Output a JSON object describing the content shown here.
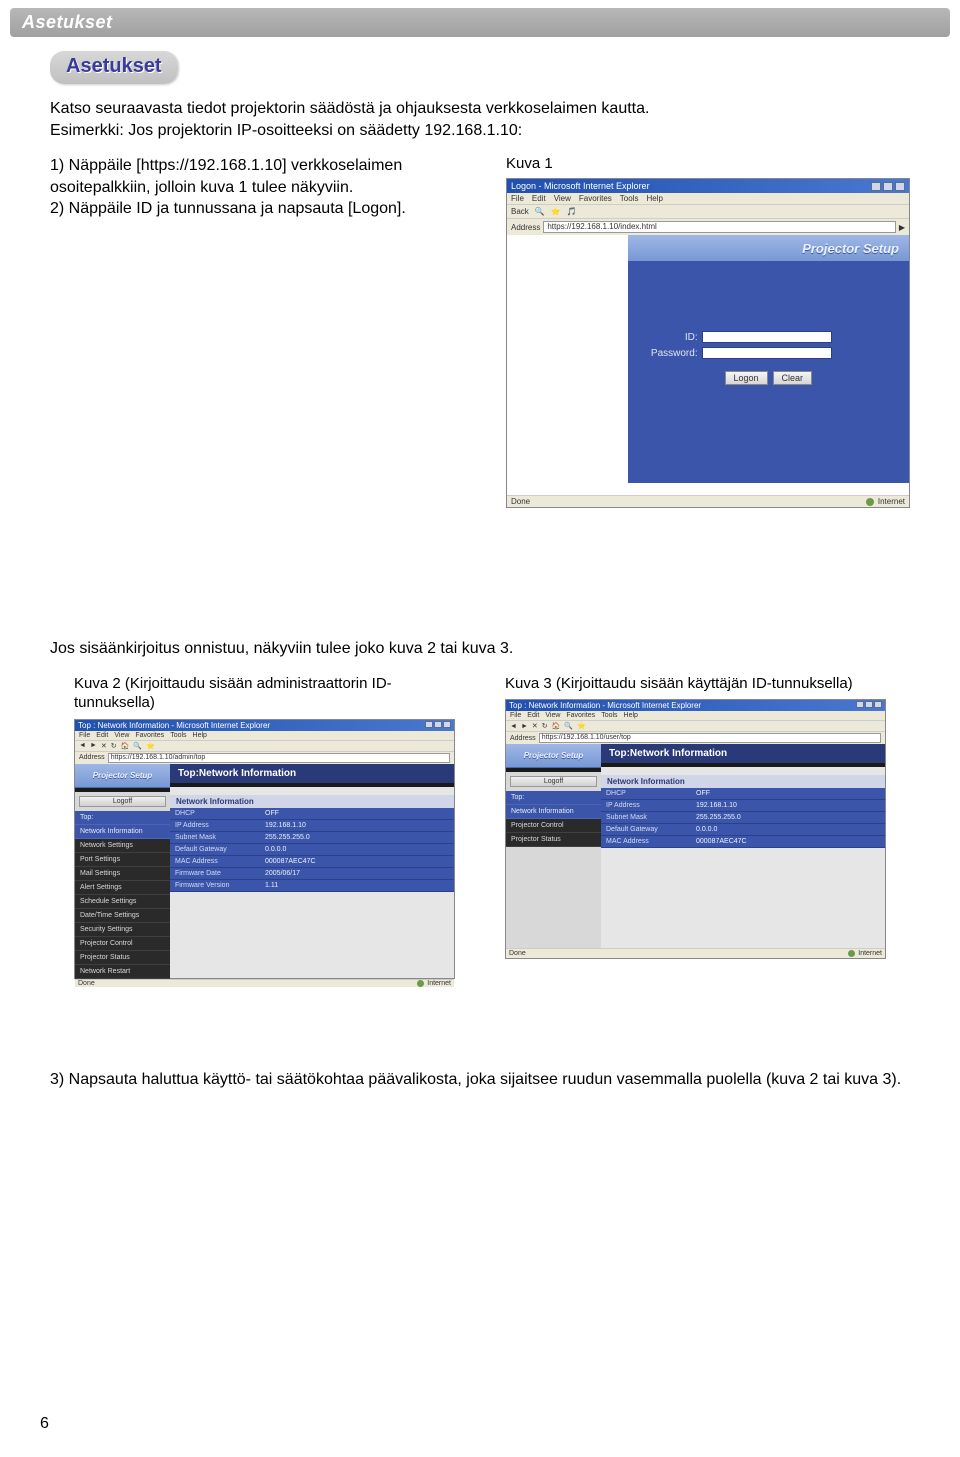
{
  "header": {
    "title": "Asetukset"
  },
  "tab": {
    "label": "Asetukset"
  },
  "intro": "Katso seuraavasta tiedot projektorin säädöstä ja ohjauksesta verkkoselaimen kautta.\nEsimerkki: Jos projektorin IP-osoitteeksi on säädetty 192.168.1.10:",
  "steps": {
    "step1": "1) Näppäile [https://192.168.1.10] verkkoselaimen osoitepalkkiin, jolloin kuva 1 tulee näkyviin.",
    "step2": "2) Näppäile ID ja tunnussana ja napsauta [Logon]."
  },
  "fig1": {
    "caption": "Kuva 1",
    "window_title": "Logon - Microsoft Internet Explorer",
    "menu": [
      "File",
      "Edit",
      "View",
      "Favorites",
      "Tools",
      "Help"
    ],
    "toolbar_items": [
      "Back",
      "",
      "",
      "",
      "Search",
      "Favorites",
      "Media"
    ],
    "address_label": "Address",
    "address_value": "https://192.168.1.10/index.html",
    "panel_title": "Projector Setup",
    "fields": {
      "id_label": "ID:",
      "pw_label": "Password:"
    },
    "buttons": {
      "logon": "Logon",
      "clear": "Clear"
    },
    "status_left": "Done",
    "status_right": "Internet"
  },
  "midtext": "Jos sisäänkirjoitus onnistuu, näkyviin tulee joko kuva 2 tai kuva 3.",
  "fig2": {
    "caption": "Kuva 2 (Kirjoittaudu sisään administraattorin ID-tunnuksella)",
    "window_title": "Top : Network Information - Microsoft Internet Explorer",
    "menu": [
      "File",
      "Edit",
      "View",
      "Favorites",
      "Tools",
      "Help"
    ],
    "address_label": "Address",
    "address_value": "https://192.168.1.10/admin/top",
    "setup_title": "Projector Setup",
    "main_title": "Top:Network Information",
    "subtitle": "Network Information",
    "logoff": "Logoff",
    "side_highlight1": "Top:",
    "side_highlight2": "Network Information",
    "side_items": [
      "Network Settings",
      "Port Settings",
      "Mail Settings",
      "Alert Settings",
      "Schedule Settings",
      "Date/Time Settings",
      "Security Settings",
      "Projector Control",
      "Projector Status",
      "Network Restart"
    ],
    "kv": [
      {
        "k": "DHCP",
        "v": "OFF"
      },
      {
        "k": "IP Address",
        "v": "192.168.1.10"
      },
      {
        "k": "Subnet Mask",
        "v": "255.255.255.0"
      },
      {
        "k": "Default Gateway",
        "v": "0.0.0.0"
      },
      {
        "k": "MAC Address",
        "v": "000087AEC47C"
      },
      {
        "k": "Firmware Date",
        "v": "2005/06/17"
      },
      {
        "k": "Firmware Version",
        "v": "1.11"
      }
    ],
    "status_left": "Done",
    "status_right": "Internet"
  },
  "fig3": {
    "caption": "Kuva 3 (Kirjoittaudu sisään käyttäjän ID-tunnuksella)",
    "window_title": "Top : Network Information - Microsoft Internet Explorer",
    "menu": [
      "File",
      "Edit",
      "View",
      "Favorites",
      "Tools",
      "Help"
    ],
    "address_label": "Address",
    "address_value": "https://192.168.1.10/user/top",
    "setup_title": "Projector Setup",
    "main_title": "Top:Network Information",
    "subtitle": "Network Information",
    "logoff": "Logoff",
    "side_highlight1": "Top:",
    "side_highlight2": "Network Information",
    "side_items": [
      "Projector Control",
      "Projector Status"
    ],
    "kv": [
      {
        "k": "DHCP",
        "v": "OFF"
      },
      {
        "k": "IP Address",
        "v": "192.168.1.10"
      },
      {
        "k": "Subnet Mask",
        "v": "255.255.255.0"
      },
      {
        "k": "Default Gateway",
        "v": "0.0.0.0"
      },
      {
        "k": "MAC Address",
        "v": "000087AEC47C"
      }
    ],
    "status_left": "Done",
    "status_right": "Internet"
  },
  "step3": "3) Napsauta haluttua käyttö- tai säätökohtaa päävalikosta, joka sijaitsee ruudun vasemmalla puolella (kuva 2 tai kuva 3).",
  "page_number": "6"
}
